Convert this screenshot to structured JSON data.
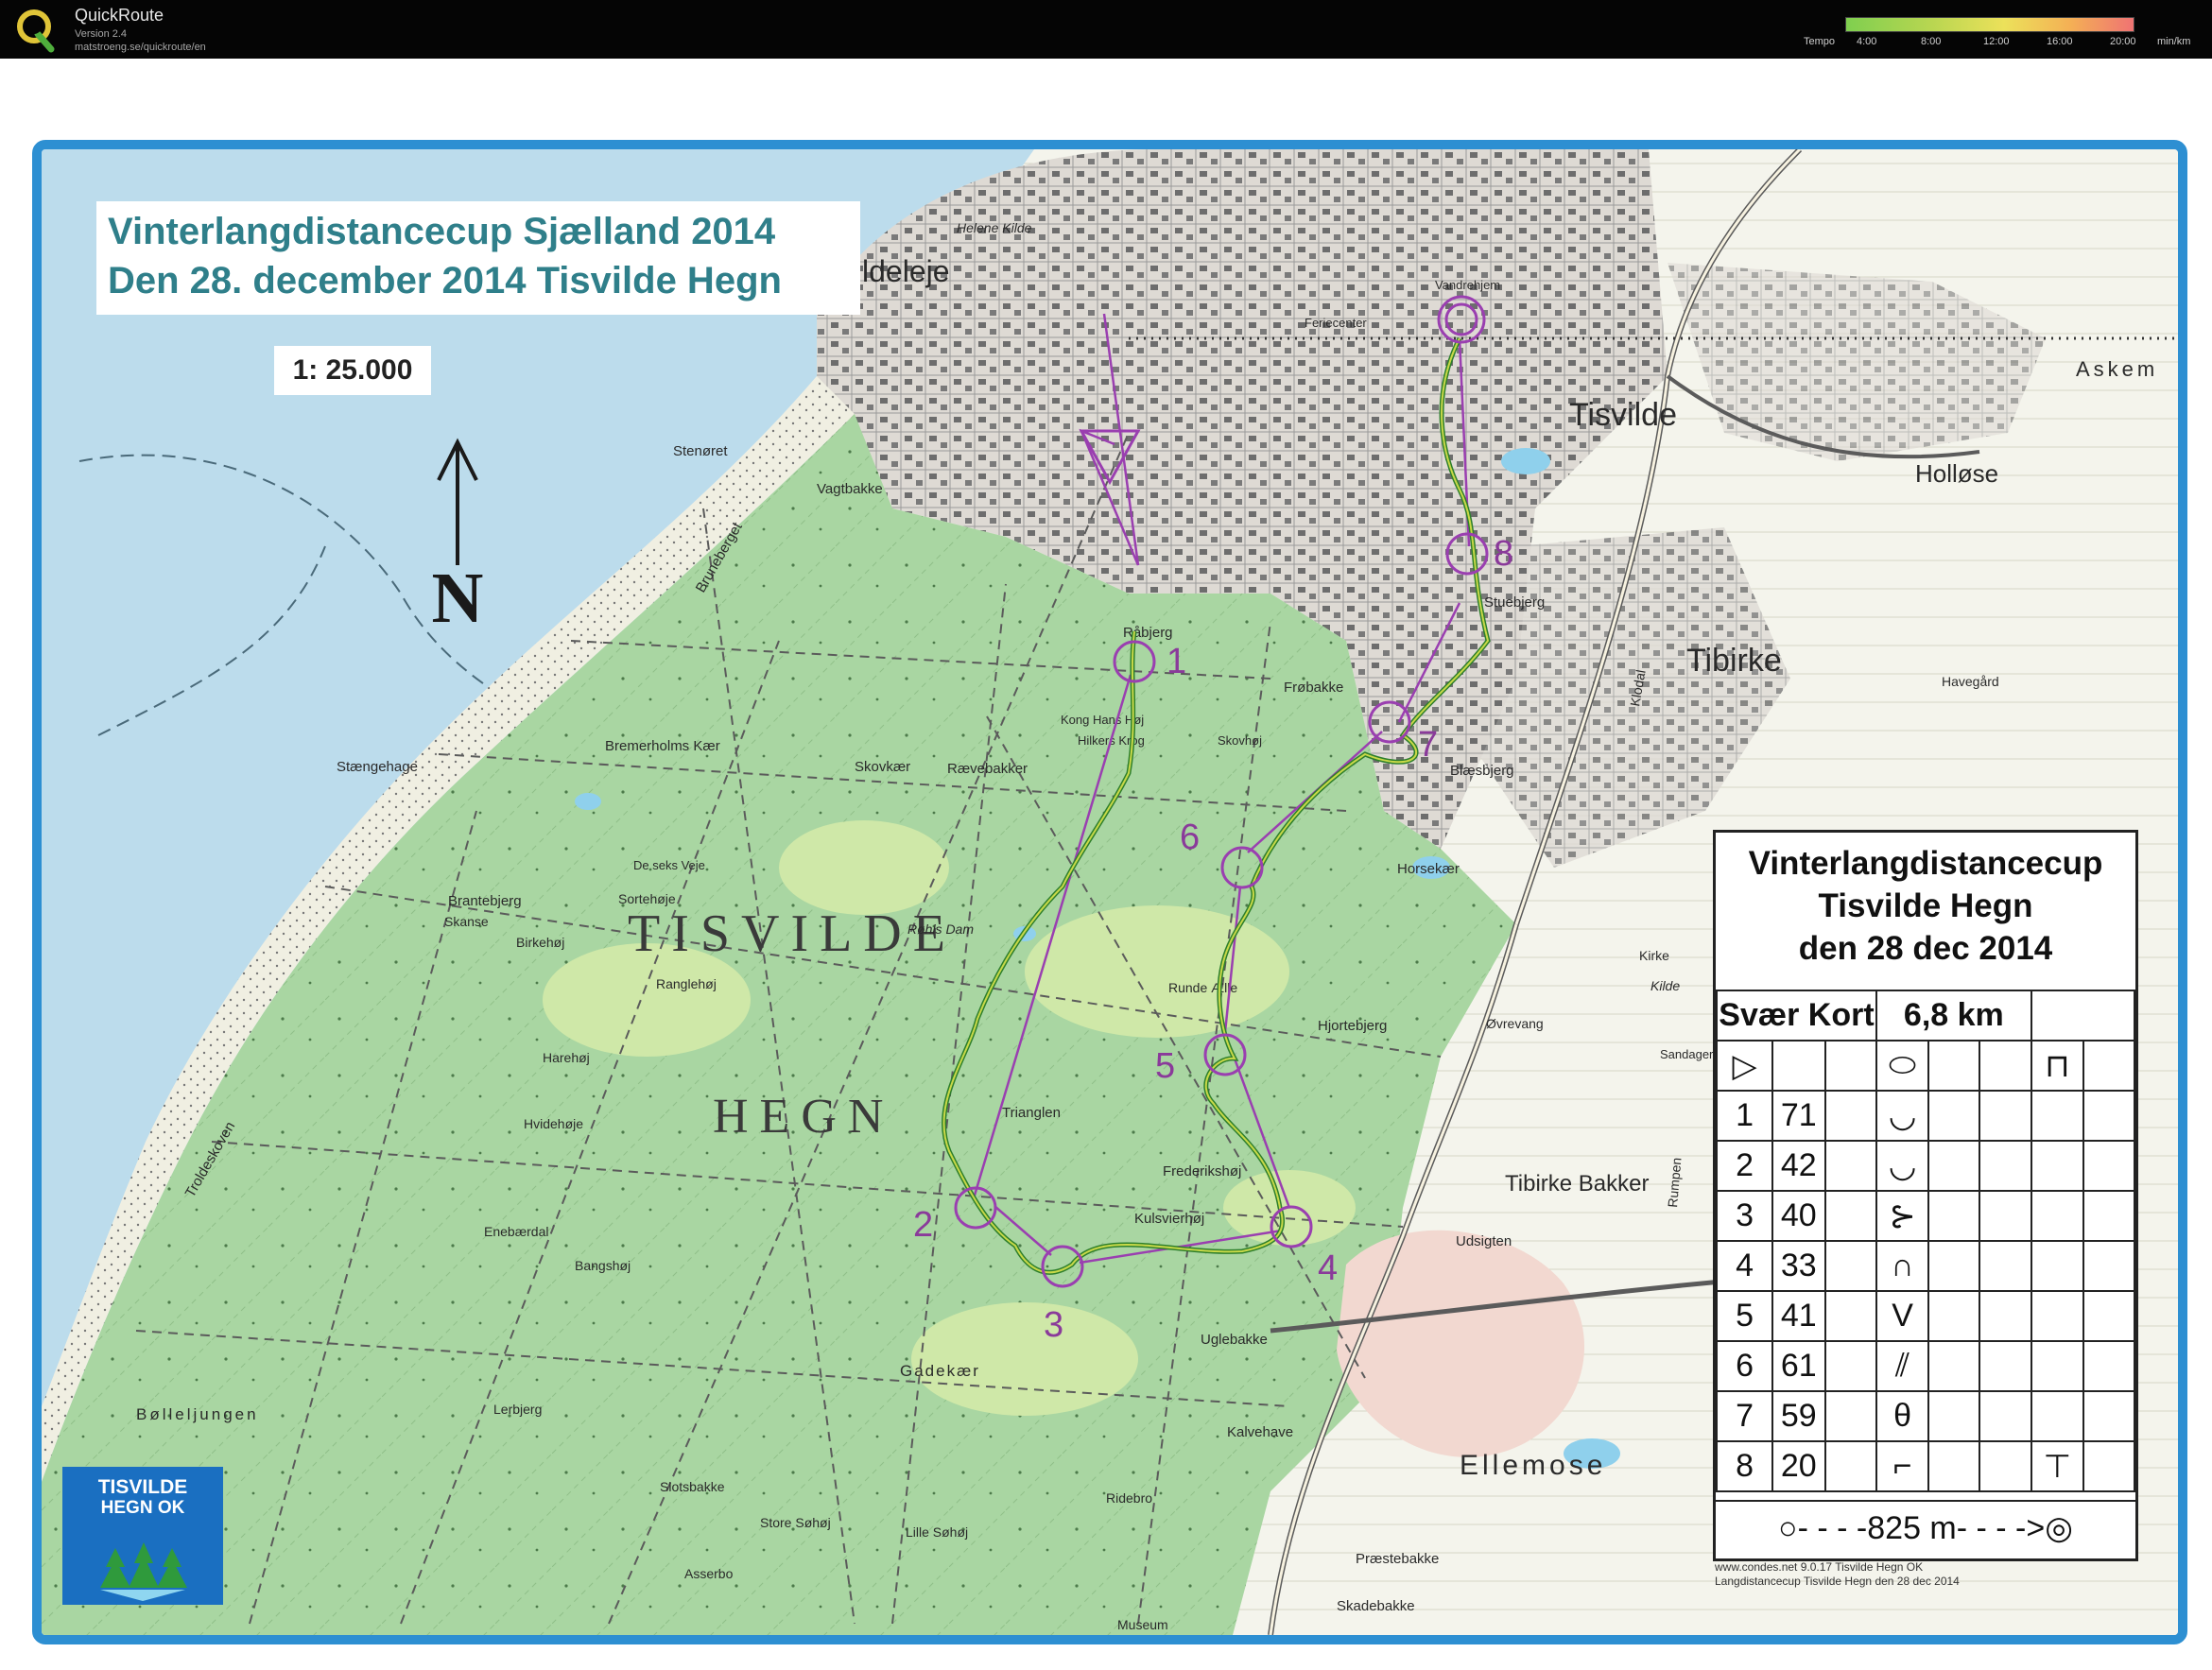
{
  "app": {
    "name": "QuickRoute",
    "version": "Version 2.4",
    "url": "matstroeng.se/quickroute/en",
    "legend": {
      "label": "Tempo",
      "ticks": [
        "4:00",
        "8:00",
        "12:00",
        "16:00",
        "20:00"
      ],
      "unit": "min/km"
    }
  },
  "map": {
    "title_line1": "Vinterlangdistancecup Sjælland 2014",
    "title_line2": "Den 28. december 2014 Tisvilde Hegn",
    "scale": "1: 25.000",
    "north": "N",
    "area_label1": "TISVILDE",
    "area_label2": "HEGN",
    "places": {
      "tisvilde": "Tisvilde",
      "tibirke": "Tibirke",
      "holloese": "Holløse",
      "askem": "Askem",
      "tibirke_bakker": "Tibirke Bakker",
      "ellemose": "Ellemose",
      "stoenoeret": "Stenøret",
      "staengehage": "Stængehage",
      "ldeleje": "ldeleje",
      "helene_kilde": "Helene Kilde",
      "vagtbakke": "Vagtbakke",
      "raabjerg": "Råbjerg",
      "frobakke": "Frøbakke",
      "skovkaer": "Skovkær",
      "raevebakker": "Rævebakker",
      "bremerholms_kaer": "Bremerholms Kær",
      "brantebjerg": "Brantebjerg",
      "sortehoeje": "Sortehøje",
      "skanse": "Skanse",
      "birkehoej": "Birkehøj",
      "ranglehoej": "Ranglehøj",
      "harehoej": "Harehøj",
      "hvidehoeje": "Hvidehøje",
      "enebaerdal": "Enebærdal",
      "bangshoej": "Bangshøj",
      "loerbjerg": "Lerbjerg",
      "boelleljungen": "Bølleljungen",
      "slotsbakke": "Slotsbakke",
      "store_sohoej": "Store Søhøj",
      "lille_sohoej": "Lille Søhøj",
      "asserbo": "Asserbo",
      "ridebro": "Ridebro",
      "museum": "Museum",
      "praestebakke": "Præstebakke",
      "skadebakke": "Skadebakke",
      "trianglen": "Trianglen",
      "frederikshoj": "Frederikshøj",
      "kulsvierhoj": "Kulsvierhøj",
      "runde_aelle": "Runde Ælle",
      "hjortebjerg": "Hjortebjerg",
      "horsekaer": "Horsekær",
      "blaesbjerg": "Blæsbjerg",
      "stuebjerg": "Stuebjerg",
      "uglebakke": "Uglebakke",
      "gadekaer": "Gadekær",
      "kong_hans": "Kong Hans Høj",
      "hilkers_krog": "Hilkers Krog",
      "skovhoj": "Skovhøj",
      "rohls_dam": "Røhls Dam",
      "de_seks_veje": "De seks Veje",
      "troldeskoven": "Troldeskoven",
      "bruneberget": "Bruneberget",
      "udsigten": "Udsigten",
      "kalvehave": "Kalvehave",
      "orevang": "Øvrevang",
      "kirke": "Kirke",
      "kilde": "Kilde",
      "sandager": "Sandager",
      "rumpen": "Rumpen",
      "kildal": "Klodal",
      "havegard": "Havegård",
      "vandrehjem": "Vandrehjem",
      "feriecenter": "Feriecenter"
    },
    "controls": [
      "1",
      "2",
      "3",
      "4",
      "5",
      "6",
      "7",
      "8"
    ]
  },
  "club": {
    "line1": "TISVILDE",
    "line2": "HEGN OK"
  },
  "description": {
    "title_line1": "Vinterlangdistancecup",
    "title_line2": "Tisvilde Hegn",
    "title_line3": "den 28 dec 2014",
    "course": "Svær Kort",
    "length": "6,8 km",
    "controls": [
      {
        "num": "1",
        "code": "71",
        "symbol": "◡"
      },
      {
        "num": "2",
        "code": "42",
        "symbol": "◡"
      },
      {
        "num": "3",
        "code": "40",
        "symbol": "⊱"
      },
      {
        "num": "4",
        "code": "33",
        "symbol": "∩"
      },
      {
        "num": "5",
        "code": "41",
        "symbol": "V"
      },
      {
        "num": "6",
        "code": "61",
        "symbol": "⫽"
      },
      {
        "num": "7",
        "code": "59",
        "symbol": "θ"
      },
      {
        "num": "8",
        "code": "20",
        "symbol": "⌐"
      }
    ],
    "start_symbol": "▷",
    "start_feature": "⬭",
    "start_extra": "⊓",
    "control8_extra": "⊤",
    "finish": "○- - - -825 m- - - ->◎",
    "credit_line1": "www.condes.net 9.0.17 Tisvilde Hegn OK",
    "credit_line2": "Langdistancecup Tisvilde Hegn den 28 dec 2014"
  }
}
